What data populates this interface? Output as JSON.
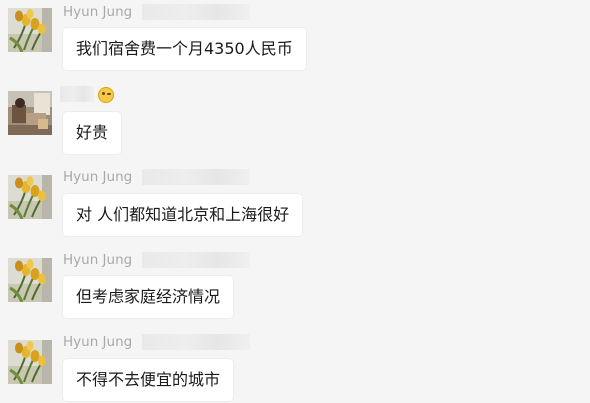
{
  "messages": [
    {
      "sender": "Hyun Jung",
      "text": "我们宿舍费一个月4350人民币",
      "avatar": "tulips"
    },
    {
      "sender": "",
      "sender_emoji": "smiling-face-icon",
      "text": "好贵",
      "avatar": "photo"
    },
    {
      "sender": "Hyun Jung",
      "text": "对 人们都知道北京和上海很好",
      "avatar": "tulips"
    },
    {
      "sender": "Hyun Jung",
      "text": "但考虑家庭经济情况",
      "avatar": "tulips"
    },
    {
      "sender": "Hyun Jung",
      "text": "不得不去便宜的城市",
      "avatar": "tulips"
    }
  ],
  "colors": {
    "background": "#f5f5f5",
    "bubble": "#ffffff",
    "sender_name": "#a9a9a9",
    "message_text": "#1a1a1a"
  }
}
